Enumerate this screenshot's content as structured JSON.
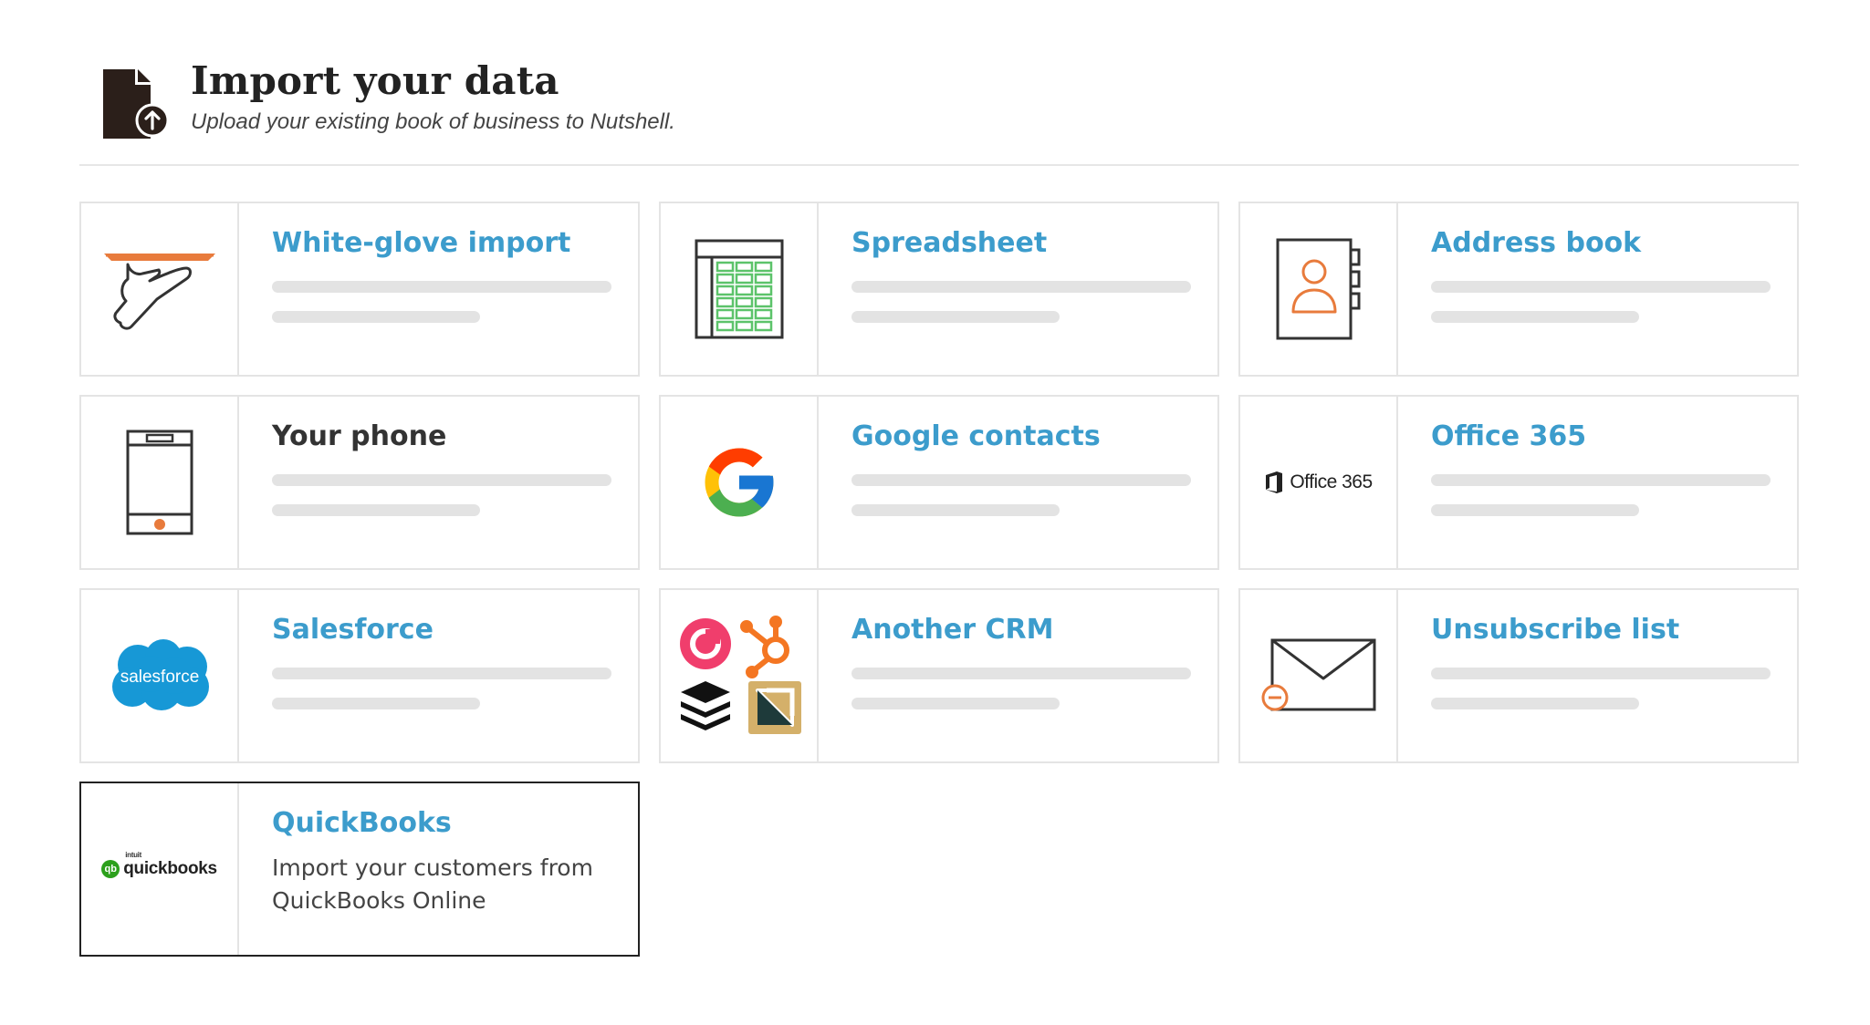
{
  "header": {
    "title": "Import your data",
    "subtitle": "Upload your existing book of business to Nutshell.",
    "icon": "file-upload-icon"
  },
  "options": [
    {
      "name": "White-glove import",
      "icon": "serving-tray-hand-icon",
      "selected": false
    },
    {
      "name": "Spreadsheet",
      "icon": "spreadsheet-icon",
      "selected": false
    },
    {
      "name": "Address book",
      "icon": "address-book-icon",
      "selected": false
    },
    {
      "name": "Your phone",
      "icon": "phone-icon",
      "selected": false
    },
    {
      "name": "Google contacts",
      "icon": "google-logo",
      "selected": false
    },
    {
      "name": "Office 365",
      "icon": "office-365-logo",
      "logo_text": "Office 365",
      "selected": false
    },
    {
      "name": "Salesforce",
      "icon": "salesforce-logo",
      "logo_text": "salesforce",
      "selected": false
    },
    {
      "name": "Another CRM",
      "icon": "crm-logos-icon",
      "selected": false
    },
    {
      "name": "Unsubscribe list",
      "icon": "envelope-minus-icon",
      "selected": false
    },
    {
      "name": "QuickBooks",
      "icon": "quickbooks-logo",
      "logo_text": "quickbooks",
      "logo_subtext": "intuit",
      "logo_badge": "qb",
      "description": "Import your customers from QuickBooks Online",
      "selected": true
    }
  ],
  "colors": {
    "link": "#3c9ccc",
    "accent_orange": "#e87b3c",
    "spreadsheet_green": "#5cc36a",
    "card_border": "#e4e4e4",
    "placeholder_bar": "#e3e3e3"
  }
}
